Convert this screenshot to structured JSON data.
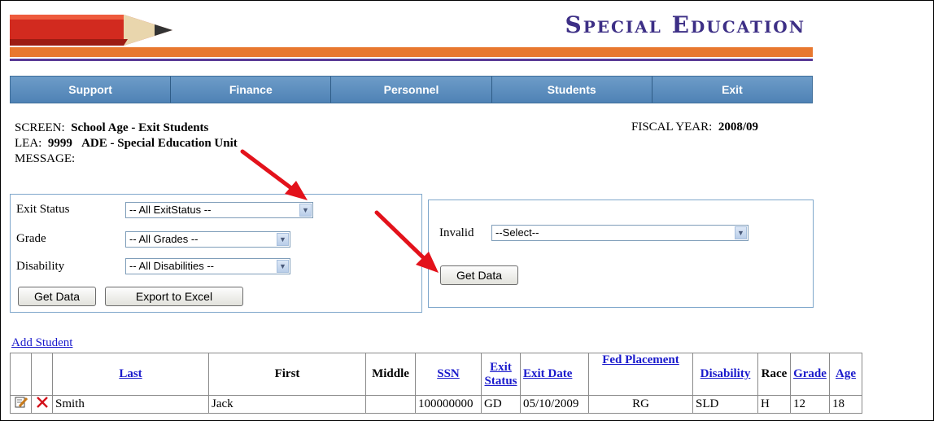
{
  "header": {
    "app_title": "Special Education"
  },
  "nav": [
    {
      "label": "Support"
    },
    {
      "label": "Finance"
    },
    {
      "label": "Personnel"
    },
    {
      "label": "Students"
    },
    {
      "label": "Exit"
    }
  ],
  "info": {
    "screen_label": "SCREEN:",
    "screen_value": "School Age - Exit Students",
    "lea_label": "LEA:",
    "lea_code": "9999",
    "lea_name": "ADE - Special Education Unit",
    "message_label": "MESSAGE:",
    "fiscal_label": "FISCAL YEAR:",
    "fiscal_value": "2008/09"
  },
  "filters": {
    "exit_status_label": "Exit Status",
    "exit_status_value": "-- All ExitStatus --",
    "grade_label": "Grade",
    "grade_value": "-- All Grades --",
    "disability_label": "Disability",
    "disability_value": "-- All Disabilities --",
    "get_data_label": "Get Data",
    "export_label": "Export to Excel"
  },
  "invalid_filter": {
    "label": "Invalid",
    "value": "--Select--",
    "get_data_label": "Get Data"
  },
  "table": {
    "add_student_label": "Add Student",
    "columns": [
      "Last",
      "First",
      "Middle",
      "SSN",
      "Exit Status",
      "Exit Date",
      "Fed Placement",
      "Disability",
      "Race",
      "Grade",
      "Age"
    ],
    "rows": [
      {
        "last": "Smith",
        "first": "Jack",
        "middle": "",
        "ssn": "100000000",
        "exit_status": "GD",
        "exit_date": "05/10/2009",
        "fed_placement": "RG",
        "disability": "SLD",
        "race": "H",
        "grade": "12",
        "age": "18"
      }
    ]
  },
  "colors": {
    "title": "#3d2f86",
    "orange_rule": "#e8782f",
    "nav_bg": "#5b8ec0",
    "link": "#1a1acc",
    "arrow": "#e3121b"
  }
}
